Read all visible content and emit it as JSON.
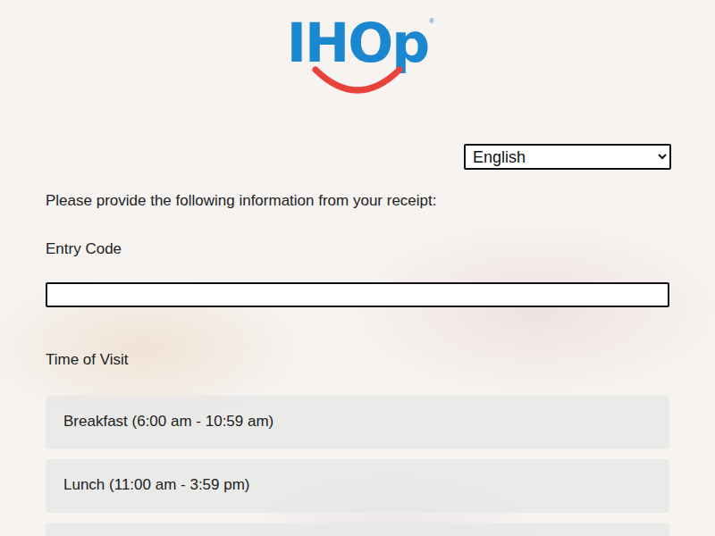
{
  "logo": {
    "text": "IHOp",
    "mark": "®"
  },
  "language": {
    "value": "English"
  },
  "instructions": "Please provide the following information from your receipt:",
  "entry_code": {
    "label": "Entry Code",
    "value": ""
  },
  "time_of_visit": {
    "label": "Time of Visit",
    "options": [
      {
        "label": "Breakfast (6:00 am - 10:59 am)",
        "selected": false
      },
      {
        "label": "Lunch (11:00 am - 3:59 pm)",
        "selected": false
      }
    ]
  }
}
